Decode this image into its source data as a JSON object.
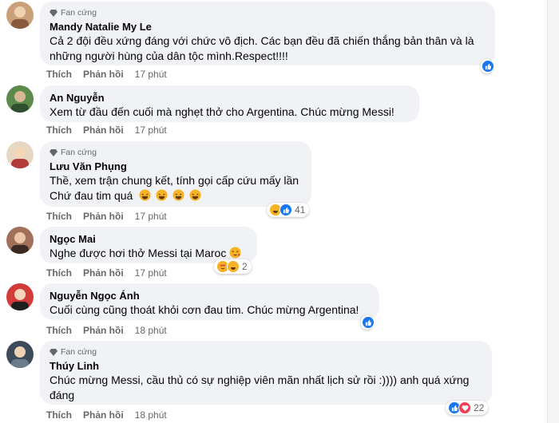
{
  "fan_badge_label": "Fan cứng",
  "like_label": "Thích",
  "reply_label": "Phản hồi",
  "comments": [
    {
      "name": "Mandy Natalie My Le",
      "fan": true,
      "text": "Cả 2 đội đều xứng đáng với chức vô địch. Các bạn đều đã chiến thắng bản thân và là những người hùng của dân tộc mình.Respect!!!!",
      "time": "17 phút",
      "reaction_count": ""
    },
    {
      "name": "An Nguyễn",
      "fan": false,
      "text": "Xem từ đầu đến cuối mà nghẹt thở cho Argentina. Chúc mừng Messi!",
      "time": "17 phút",
      "reaction_count": ""
    },
    {
      "name": "Lưu Văn Phụng",
      "fan": true,
      "text_line1": "Thề, xem trận chung kết, tính gọi cấp cứu mấy lần",
      "text_line2": "Chứ đau tim quá",
      "time": "17 phút",
      "reaction_count": "41"
    },
    {
      "name": "Ngọc Mai",
      "fan": false,
      "text": "Nghe được hơi thở Messi tại Maroc",
      "time": "17 phút",
      "reaction_count": "2"
    },
    {
      "name": "Nguyễn Ngọc Ánh",
      "fan": false,
      "text": "Cuối cùng cũng thoát khỏi cơn đau tim. Chúc mừng Argentina!",
      "time": "18 phút",
      "reaction_count": ""
    },
    {
      "name": "Thúy Linh",
      "fan": true,
      "text": "Chúc mừng Messi, cầu thủ có sự nghiệp viên mãn nhất lịch sử rồi :)))) anh quá xứng đáng",
      "time": "18 phút",
      "reaction_count": "22"
    }
  ],
  "colors": {
    "bubble": "#f0f2f5",
    "meta": "#65676b",
    "like": "#1877f2",
    "haha": "#f7b125"
  }
}
